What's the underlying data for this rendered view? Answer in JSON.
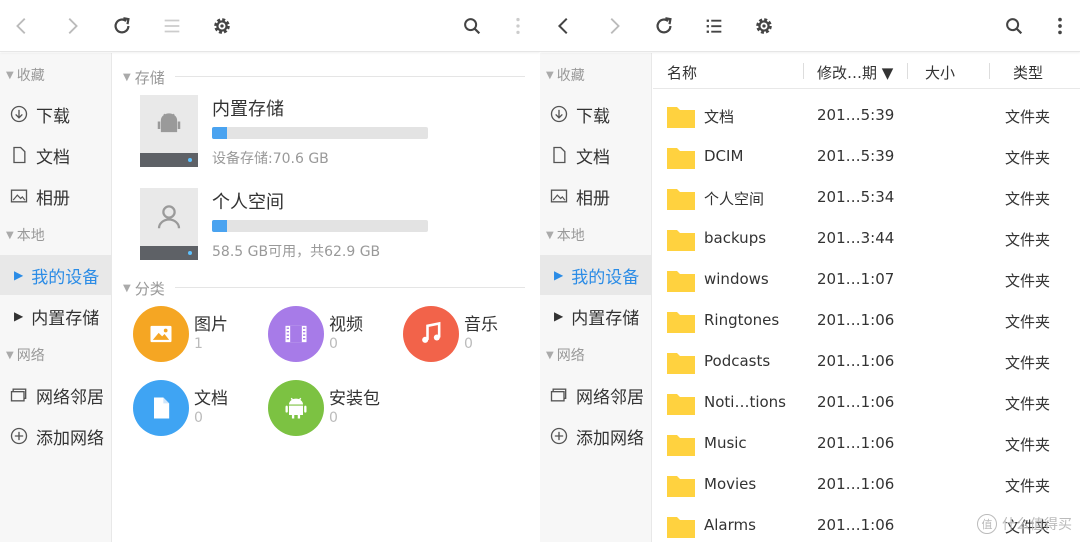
{
  "left": {
    "sidebar": {
      "favorites": "收藏",
      "fav_items": [
        "下载",
        "文档",
        "相册"
      ],
      "local": "本地",
      "local_items": [
        "我的设备",
        "内置存储"
      ],
      "network": "网络",
      "net_items": [
        "网络邻居",
        "添加网络"
      ]
    },
    "storage_section": "存储",
    "storage": [
      {
        "name": "内置存储",
        "info": "设备存储:70.6 GB",
        "used_fraction": 0.07
      },
      {
        "name": "个人空间",
        "info": "58.5 GB可用，共62.9 GB",
        "used_fraction": 0.07
      }
    ],
    "category_section": "分类",
    "categories": [
      {
        "name": "图片",
        "count": "1",
        "color": "#f5a623",
        "icon": "image-icon"
      },
      {
        "name": "视频",
        "count": "0",
        "color": "#a77be8",
        "icon": "film-icon"
      },
      {
        "name": "音乐",
        "count": "0",
        "color": "#f2634a",
        "icon": "music-icon"
      },
      {
        "name": "文档",
        "count": "0",
        "color": "#3fa4f3",
        "icon": "document-icon"
      },
      {
        "name": "安装包",
        "count": "0",
        "color": "#7cc242",
        "icon": "android-icon"
      }
    ]
  },
  "right": {
    "sidebar": {
      "favorites": "收藏",
      "fav_items": [
        "下载",
        "文档",
        "相册"
      ],
      "local": "本地",
      "local_items": [
        "我的设备",
        "内置存储"
      ],
      "network": "网络",
      "net_items": [
        "网络邻居",
        "添加网络"
      ]
    },
    "columns": {
      "name": "名称",
      "modified": "修改…期 ▼",
      "size": "大小",
      "type": "类型"
    },
    "files": [
      {
        "name": "文档",
        "date": "201…5:39",
        "type": "文件夹"
      },
      {
        "name": "DCIM",
        "date": "201…5:39",
        "type": "文件夹"
      },
      {
        "name": "个人空间",
        "date": "201…5:34",
        "type": "文件夹"
      },
      {
        "name": "backups",
        "date": "201…3:44",
        "type": "文件夹"
      },
      {
        "name": "windows",
        "date": "201…1:07",
        "type": "文件夹"
      },
      {
        "name": "Ringtones",
        "date": "201…1:06",
        "type": "文件夹"
      },
      {
        "name": "Podcasts",
        "date": "201…1:06",
        "type": "文件夹"
      },
      {
        "name": "Noti…tions",
        "date": "201…1:06",
        "type": "文件夹"
      },
      {
        "name": "Music",
        "date": "201…1:06",
        "type": "文件夹"
      },
      {
        "name": "Movies",
        "date": "201…1:06",
        "type": "文件夹"
      },
      {
        "name": "Alarms",
        "date": "201…1:06",
        "type": "文件夹"
      }
    ]
  },
  "colors": {
    "accent": "#2b8ce6",
    "folder": "#ffd23f",
    "bar": "#4aa3f0"
  },
  "watermark": "什么值得买"
}
